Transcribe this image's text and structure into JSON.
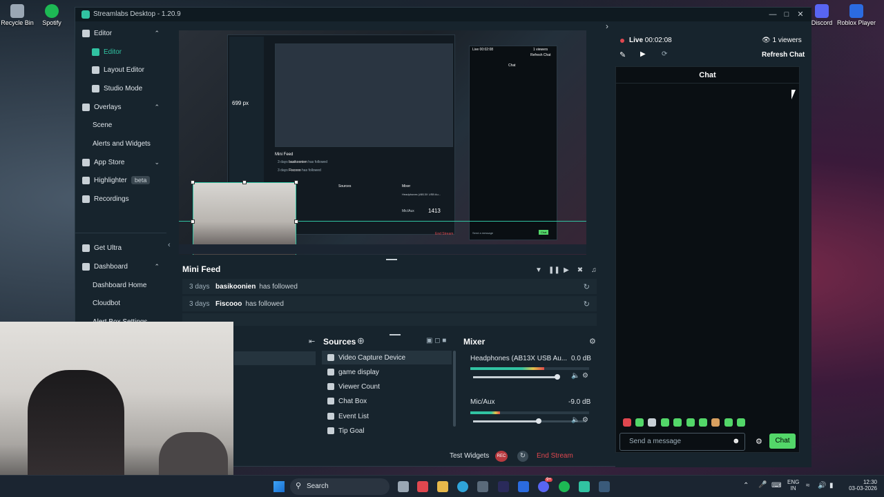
{
  "desktop": {
    "icons": [
      {
        "label": "Recycle Bin",
        "color": "#9aa7b4"
      },
      {
        "label": "Spotify",
        "color": "#1db954"
      },
      {
        "label": "Discord",
        "color": "#5865f2"
      },
      {
        "label": "Roblox Player",
        "color": "#2b6be0"
      }
    ]
  },
  "window": {
    "title": "Streamlabs Desktop - 1.20.9",
    "accent": "#31c3a2"
  },
  "sidebar": {
    "items": [
      {
        "label": "Editor",
        "icon": "grid-icon",
        "type": "section",
        "chevron": "up"
      },
      {
        "label": "Editor",
        "icon": "editor-icon",
        "type": "sub",
        "active": true
      },
      {
        "label": "Layout Editor",
        "icon": "layout-icon",
        "type": "sub"
      },
      {
        "label": "Studio Mode",
        "icon": "studio-icon",
        "type": "sub"
      },
      {
        "label": "Overlays",
        "icon": "overlays-icon",
        "type": "section",
        "chevron": "up"
      },
      {
        "label": "Scene",
        "type": "sub"
      },
      {
        "label": "Alerts and Widgets",
        "type": "sub"
      },
      {
        "label": "App Store",
        "icon": "store-icon",
        "type": "section",
        "chevron": "down"
      },
      {
        "label": "Highlighter",
        "icon": "highlighter-icon",
        "type": "section",
        "badge": "beta"
      },
      {
        "label": "Recordings",
        "icon": "recordings-icon",
        "type": "section"
      },
      {
        "label": "Get Ultra",
        "icon": "ultra-icon",
        "type": "section"
      },
      {
        "label": "Dashboard",
        "icon": "dashboard-icon",
        "type": "section",
        "chevron": "up"
      },
      {
        "label": "Dashboard Home",
        "type": "sub"
      },
      {
        "label": "Cloudbot",
        "type": "sub"
      },
      {
        "label": "Alert Box Settings",
        "type": "sub"
      }
    ]
  },
  "preview": {
    "nested_labels": {
      "px_readout": "699 px",
      "count": "1413",
      "mini_feed": "Mini Feed",
      "chat": "Chat",
      "sources": "Sources",
      "mixer": "Mixer",
      "headphones": "Headphones (AB13X USB Au...",
      "micaux": "Mic/Aux",
      "end_stream": "End Stream",
      "live": "Live 00:02:08",
      "viewers": "1 viewers",
      "refresh_chat": "Refresh Chat",
      "send_message": "Send a message",
      "chat_btn": "Chat",
      "row1_days": "3 days",
      "row1_user": "basikoonien",
      "row1_action": "has followed",
      "row2_days": "3 days",
      "row2_user": "Fiscooo",
      "row2_action": "has followed"
    }
  },
  "mini_feed": {
    "title": "Mini Feed",
    "rows": [
      {
        "days": "3 days",
        "user": "basikoonien",
        "action": "has followed"
      },
      {
        "days": "3 days",
        "user": "Fiscooo",
        "action": "has followed"
      }
    ]
  },
  "sources": {
    "title": "Sources",
    "items": [
      {
        "label": "Video Capture Device",
        "icon": "camera-icon",
        "selected": true
      },
      {
        "label": "game display",
        "icon": "display-icon"
      },
      {
        "label": "Viewer Count",
        "icon": "eye-icon"
      },
      {
        "label": "Chat Box",
        "icon": "chat-icon"
      },
      {
        "label": "Event List",
        "icon": "list-icon"
      },
      {
        "label": "Tip Goal",
        "icon": "goal-icon"
      }
    ]
  },
  "mixer": {
    "title": "Mixer",
    "channels": [
      {
        "name": "Headphones (AB13X USB Au...",
        "db": "0.0 dB",
        "level": 0.62,
        "volume": 0.98
      },
      {
        "name": "Mic/Aux",
        "db": "-9.0 dB",
        "level": 0.25,
        "volume": 0.58
      }
    ]
  },
  "footer": {
    "test_widgets": "Test Widgets",
    "rec": "REC",
    "end_stream": "End Stream"
  },
  "chat": {
    "live_label": "Live",
    "live_time": "00:02:08",
    "viewers": "1 viewers",
    "refresh": "Refresh Chat",
    "title": "Chat",
    "placeholder": "Send a message",
    "send_label": "Chat",
    "live_color": "#e0474f",
    "send_color": "#53d769"
  },
  "taskbar": {
    "search_label": "Search",
    "lang": "ENG",
    "region": "IN",
    "time": "12:30",
    "date": "03-03-2026",
    "badge": "9+"
  }
}
